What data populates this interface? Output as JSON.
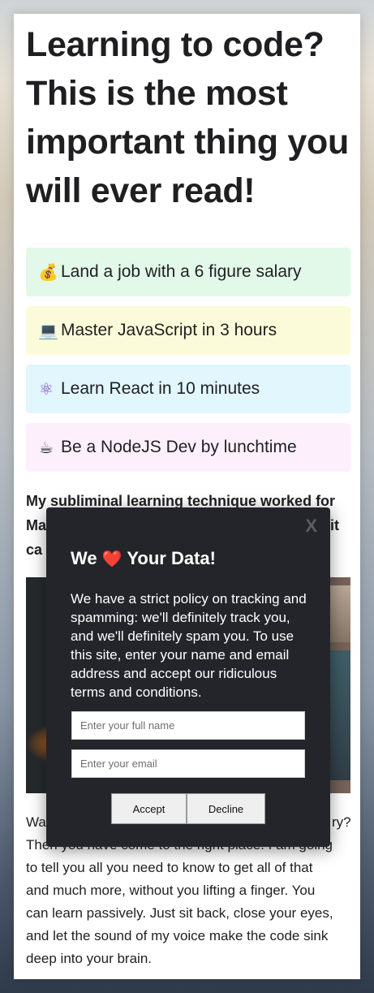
{
  "headline": "Learning to code? This is the most important thing you will ever read!",
  "promos": [
    {
      "emoji": "💰",
      "icon": "money-bag-icon",
      "text": "Land a job with a 6 figure salary",
      "color": "#e2f8e8"
    },
    {
      "emoji": "💻",
      "icon": "laptop-icon",
      "text": "Master JavaScript in 3 hours",
      "color": "#fcfbd9"
    },
    {
      "emoji": "⚛",
      "icon": "atom-icon",
      "text": "Learn React in 10 minutes",
      "color": "#e1f6fd"
    },
    {
      "emoji": "☕",
      "icon": "coffee-icon",
      "text": "Be a NodeJS Dev by lunchtime",
      "color": "#fdf0fc"
    }
  ],
  "subliminal_text": "My subliminal learning technique worked for Ma… it ca…",
  "subliminal_lines": {
    "line1": "My subliminal learning technique worked for",
    "line2_start": "Ma",
    "line2_end": "it",
    "line3": "ca"
  },
  "body_text": {
    "line1_start": "Wa",
    "line1_end": "ry?",
    "line2": "Then you have come to the right place. I am going",
    "line3": "to tell you all you need to know to get all of that",
    "line4": "and much more, without you lifting a finger. You",
    "line5": "can learn passively. Just sit back, close your eyes,",
    "line6": "and let the sound of my voice make the code sink",
    "line7": "deep into your brain."
  },
  "modal": {
    "close_label": "X",
    "title_prefix": "We",
    "title_heart": "❤️",
    "title_suffix": "Your Data!",
    "message": "We have a strict policy on tracking and spamming: we'll definitely track you, and we'll definitely spam you. To use this site, enter your name and email address and accept our ridiculous terms and conditions.",
    "name_placeholder": "Enter your full name",
    "email_placeholder": "Enter your email",
    "accept_label": "Accept",
    "decline_label": "Decline",
    "background": "#23252a",
    "heart_color": "#e0242b"
  }
}
